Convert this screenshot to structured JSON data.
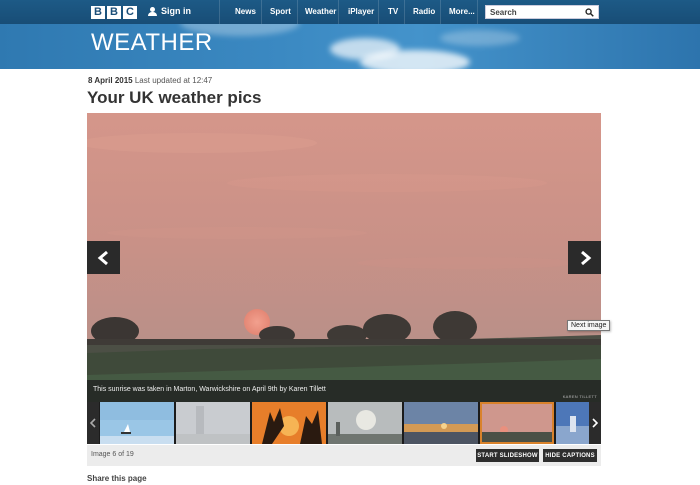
{
  "logo": {
    "letters": [
      "B",
      "B",
      "C"
    ]
  },
  "header": {
    "signin_label": "Sign in",
    "nav": [
      "News",
      "Sport",
      "Weather",
      "iPlayer",
      "TV",
      "Radio",
      "More..."
    ],
    "search_placeholder": "Search"
  },
  "banner": {
    "title": "WEATHER"
  },
  "article": {
    "date": "8 April 2015",
    "updated": "Last updated at 12:47",
    "title": "Your UK weather pics"
  },
  "gallery": {
    "caption": "This sunrise was taken in Marton, Warwickshire on April 9th by Karen Tillett",
    "credit": "KAREN TILLETT",
    "tooltip": "Next image",
    "counter": "Image 6 of 19",
    "current_index": 6,
    "total_images": 19,
    "selected_thumbnail": 6,
    "start_slideshow": "START SLIDESHOW",
    "hide_captions": "HIDE CAPTIONS",
    "prev_icon": "chevron-left-icon",
    "next_icon": "chevron-right-icon"
  },
  "share": {
    "label": "Share this page"
  },
  "colors": {
    "nav_bg": "#1b5280",
    "banner_bg": "#3483bd",
    "selected_thumb_border": "#d9822b",
    "button_bg": "#2e2e2e"
  }
}
